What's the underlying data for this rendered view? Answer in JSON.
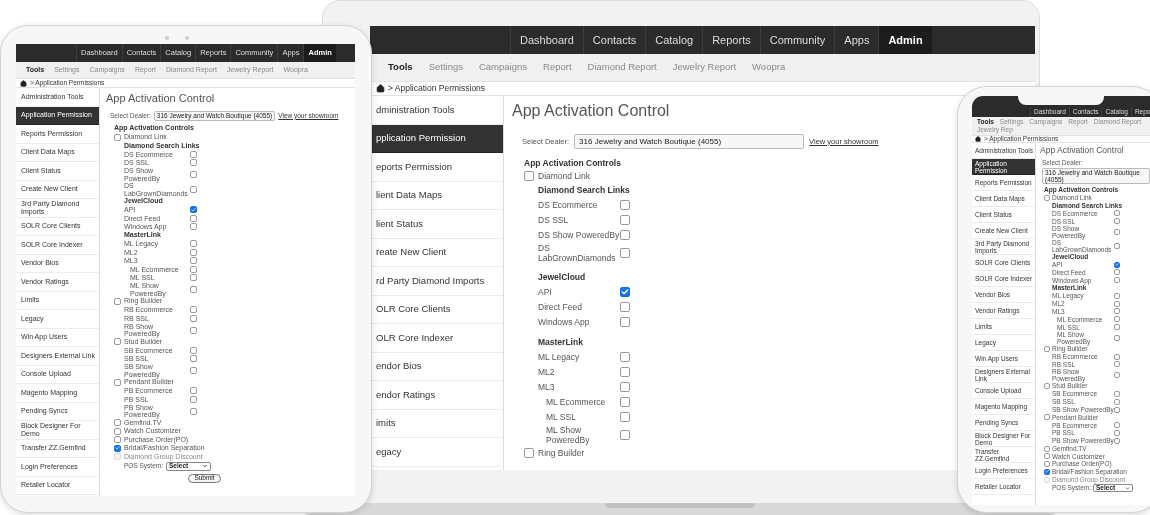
{
  "devices": [
    {
      "kind": "tablet",
      "screen": {
        "nav": [
          {
            "label": "Dashboard",
            "selected": false
          },
          {
            "label": "Contacts",
            "selected": false
          },
          {
            "label": "Catalog",
            "selected": false
          },
          {
            "label": "Reports",
            "selected": false
          },
          {
            "label": "Community",
            "selected": false
          },
          {
            "label": "Apps",
            "selected": false
          },
          {
            "label": "Admin",
            "selected": true
          }
        ],
        "subnav": [
          {
            "label": "Tools",
            "selected": true
          },
          {
            "label": "Settings",
            "selected": false
          },
          {
            "label": "Campaigns",
            "selected": false
          },
          {
            "label": "Report",
            "selected": false
          },
          {
            "label": "Diamond Report",
            "selected": false
          },
          {
            "label": "Jewelry Report",
            "selected": false
          },
          {
            "label": "Woopra",
            "selected": false
          }
        ],
        "breadcrumb": "> Application Permissions",
        "sidebar": [
          {
            "label": "Administration Tools",
            "selected": false
          },
          {
            "label": "Application Permission",
            "selected": true
          },
          {
            "label": "Reports Permission",
            "selected": false
          },
          {
            "label": "Client Data Maps",
            "selected": false
          },
          {
            "label": "Client Status",
            "selected": false
          },
          {
            "label": "Create New Client",
            "selected": false
          },
          {
            "label": "3rd Party Diamond Imports",
            "selected": false
          },
          {
            "label": "SOLR Core Clients",
            "selected": false
          },
          {
            "label": "SOLR Core Indexer",
            "selected": false
          },
          {
            "label": "Vendor Bios",
            "selected": false
          },
          {
            "label": "Vendor Ratings",
            "selected": false
          },
          {
            "label": "Limits",
            "selected": false
          },
          {
            "label": "Legacy",
            "selected": false
          },
          {
            "label": "Win App Users",
            "selected": false
          },
          {
            "label": "Designers External Link",
            "selected": false
          },
          {
            "label": "Console Upload",
            "selected": false
          },
          {
            "label": "Magento Mapping",
            "selected": false
          },
          {
            "label": "Pending Syncs",
            "selected": false
          },
          {
            "label": "Block Designer For Demo",
            "selected": false
          },
          {
            "label": "Transfer ZZ.Gemfind",
            "selected": false
          },
          {
            "label": "Login Preferences",
            "selected": false
          },
          {
            "label": "Retailer Locator",
            "selected": false
          }
        ],
        "title": "App Activation Control",
        "dealer": {
          "label": "Select Dealer:",
          "value": "316 Jewelry and Watch Boutique (4055)",
          "link": "View your showroom"
        },
        "controls_heading": "App Activation Controls",
        "controls": [
          {
            "kind": "toggle",
            "label": "Diamond Link",
            "checked": false,
            "disabled": false,
            "children": [
              {
                "kind": "heading",
                "label": "Diamond Search Links",
                "children": [
                  {
                    "kind": "option",
                    "label": "DS Ecommerce",
                    "checked": false
                  },
                  {
                    "kind": "option",
                    "label": "DS SSL",
                    "checked": false
                  },
                  {
                    "kind": "option",
                    "label": "DS Show PoweredBy",
                    "checked": false
                  },
                  {
                    "kind": "option",
                    "label": "DS LabGrownDiamonds",
                    "checked": false
                  }
                ]
              },
              {
                "kind": "heading",
                "label": "JewelCloud",
                "children": [
                  {
                    "kind": "option",
                    "label": "API",
                    "checked": true
                  },
                  {
                    "kind": "option",
                    "label": "Direct Feed",
                    "checked": false
                  },
                  {
                    "kind": "option",
                    "label": "Windows App",
                    "checked": false
                  }
                ]
              },
              {
                "kind": "heading",
                "label": "MasterLink",
                "children": [
                  {
                    "kind": "option",
                    "label": "ML Legacy",
                    "checked": false
                  },
                  {
                    "kind": "option",
                    "label": "ML2",
                    "checked": false
                  },
                  {
                    "kind": "option",
                    "label": "ML3",
                    "checked": false,
                    "children": [
                      {
                        "kind": "option",
                        "label": "ML Ecommerce",
                        "checked": false
                      },
                      {
                        "kind": "option",
                        "label": "ML SSL",
                        "checked": false
                      },
                      {
                        "kind": "option",
                        "label": "ML Show PoweredBy",
                        "checked": false
                      }
                    ]
                  }
                ]
              }
            ]
          },
          {
            "kind": "toggle",
            "label": "Ring Builder",
            "checked": false,
            "disabled": false,
            "children": [
              {
                "kind": "option",
                "label": "RB Ecommerce",
                "checked": false
              },
              {
                "kind": "option",
                "label": "RB SSL",
                "checked": false
              },
              {
                "kind": "option",
                "label": "RB Show PoweredBy",
                "checked": false
              }
            ]
          },
          {
            "kind": "toggle",
            "label": "Stud Builder",
            "checked": false,
            "disabled": false,
            "children": [
              {
                "kind": "option",
                "label": "SB Ecommerce",
                "checked": false
              },
              {
                "kind": "option",
                "label": "SB SSL",
                "checked": false
              },
              {
                "kind": "option",
                "label": "SB Show PoweredBy",
                "checked": false
              }
            ]
          },
          {
            "kind": "toggle",
            "label": "Pendant Builder",
            "checked": false,
            "disabled": false,
            "children": [
              {
                "kind": "option",
                "label": "PB Ecommerce",
                "checked": false
              },
              {
                "kind": "option",
                "label": "PB SSL",
                "checked": false
              },
              {
                "kind": "option",
                "label": "PB Show PoweredBy",
                "checked": false
              }
            ]
          },
          {
            "kind": "toggle",
            "label": "Gemfind.TV",
            "checked": false,
            "disabled": false
          },
          {
            "kind": "toggle",
            "label": "Watch Customizer",
            "checked": false,
            "disabled": false
          },
          {
            "kind": "toggle",
            "label": "Purchase Order(PO)",
            "checked": false,
            "disabled": false
          },
          {
            "kind": "toggle",
            "label": "Bridal/Fashion Separation",
            "checked": true,
            "disabled": false
          },
          {
            "kind": "toggle",
            "label": "Diamond Group Discount",
            "checked": false,
            "disabled": true
          }
        ],
        "pos": {
          "label": "POS System:",
          "value": "Select"
        },
        "submit": "Submit"
      }
    },
    {
      "kind": "laptop",
      "screen": {
        "nav": [
          {
            "label": "Dashboard",
            "selected": false
          },
          {
            "label": "Contacts",
            "selected": false
          },
          {
            "label": "Catalog",
            "selected": false
          },
          {
            "label": "Reports",
            "selected": false
          },
          {
            "label": "Community",
            "selected": false
          },
          {
            "label": "Apps",
            "selected": false
          },
          {
            "label": "Admin",
            "selected": true
          }
        ],
        "subnav": [
          {
            "label": "Tools",
            "selected": true
          },
          {
            "label": "Settings",
            "selected": false
          },
          {
            "label": "Campaigns",
            "selected": false
          },
          {
            "label": "Report",
            "selected": false
          },
          {
            "label": "Diamond Report",
            "selected": false
          },
          {
            "label": "Jewelry Report",
            "selected": false
          },
          {
            "label": "Woopra",
            "selected": false
          }
        ],
        "breadcrumb": "> Application Permissions",
        "sidebar": [
          {
            "label": "dministration Tools",
            "selected": false
          },
          {
            "label": "pplication Permission",
            "selected": true
          },
          {
            "label": "eports Permission",
            "selected": false
          },
          {
            "label": "lient Data Maps",
            "selected": false
          },
          {
            "label": "lient Status",
            "selected": false
          },
          {
            "label": "reate New Client",
            "selected": false
          },
          {
            "label": "rd Party Diamond Imports",
            "selected": false
          },
          {
            "label": "OLR Core Clients",
            "selected": false
          },
          {
            "label": "OLR Core Indexer",
            "selected": false
          },
          {
            "label": "endor Bios",
            "selected": false
          },
          {
            "label": "endor Ratings",
            "selected": false
          },
          {
            "label": "imits",
            "selected": false
          },
          {
            "label": "egacy",
            "selected": false
          }
        ],
        "title": "App Activation Control",
        "dealer": {
          "label": "Select Dealer:",
          "value": "316 Jewelry and Watch Boutique (4055)",
          "link": "View your showroom"
        },
        "controls_heading": "App Activation Controls",
        "controls": [
          {
            "kind": "toggle",
            "label": "Diamond Link",
            "checked": false,
            "disabled": false,
            "children": [
              {
                "kind": "heading",
                "label": "Diamond Search Links",
                "children": [
                  {
                    "kind": "option",
                    "label": "DS Ecommerce",
                    "checked": false
                  },
                  {
                    "kind": "option",
                    "label": "DS SSL",
                    "checked": false
                  },
                  {
                    "kind": "option",
                    "label": "DS Show PoweredBy",
                    "checked": false
                  },
                  {
                    "kind": "option",
                    "label": "DS LabGrownDiamonds",
                    "checked": false
                  }
                ]
              },
              {
                "kind": "heading",
                "label": "JewelCloud",
                "children": [
                  {
                    "kind": "option",
                    "label": "API",
                    "checked": true
                  },
                  {
                    "kind": "option",
                    "label": "Direct Feed",
                    "checked": false
                  },
                  {
                    "kind": "option",
                    "label": "Windows App",
                    "checked": false
                  }
                ]
              },
              {
                "kind": "heading",
                "label": "MasterLink",
                "children": [
                  {
                    "kind": "option",
                    "label": "ML Legacy",
                    "checked": false
                  },
                  {
                    "kind": "option",
                    "label": "ML2",
                    "checked": false
                  },
                  {
                    "kind": "option",
                    "label": "ML3",
                    "checked": false,
                    "children": [
                      {
                        "kind": "option",
                        "label": "ML Ecommerce",
                        "checked": false
                      },
                      {
                        "kind": "option",
                        "label": "ML SSL",
                        "checked": false
                      },
                      {
                        "kind": "option",
                        "label": "ML Show PoweredBy",
                        "checked": false
                      }
                    ]
                  }
                ]
              }
            ]
          },
          {
            "kind": "toggle",
            "label": "Ring Builder",
            "checked": false,
            "disabled": false
          }
        ]
      }
    },
    {
      "kind": "phone",
      "screen": {
        "nav": [
          {
            "label": "Dashboard",
            "selected": false
          },
          {
            "label": "Contacts",
            "selected": false
          },
          {
            "label": "Catalog",
            "selected": false
          },
          {
            "label": "Repo",
            "selected": false
          }
        ],
        "subnav": [
          {
            "label": "Tools",
            "selected": true
          },
          {
            "label": "Settings",
            "selected": false
          },
          {
            "label": "Campaigns",
            "selected": false
          },
          {
            "label": "Report",
            "selected": false
          },
          {
            "label": "Diamond Report",
            "selected": false
          },
          {
            "label": "Jewelry Rep",
            "selected": false
          }
        ],
        "breadcrumb": "> Application Permissions",
        "sidebar": [
          {
            "label": "Administration Tools",
            "selected": false
          },
          {
            "label": "Application Permission",
            "selected": true
          },
          {
            "label": "Reports Permission",
            "selected": false
          },
          {
            "label": "Client Data Maps",
            "selected": false
          },
          {
            "label": "Client Status",
            "selected": false
          },
          {
            "label": "Create New Client",
            "selected": false
          },
          {
            "label": "3rd Party Diamond Imports",
            "selected": false
          },
          {
            "label": "SOLR Core Clients",
            "selected": false
          },
          {
            "label": "SOLR Core Indexer",
            "selected": false
          },
          {
            "label": "Vendor Bios",
            "selected": false
          },
          {
            "label": "Vendor Ratings",
            "selected": false
          },
          {
            "label": "Limits",
            "selected": false
          },
          {
            "label": "Legacy",
            "selected": false
          },
          {
            "label": "Win App Users",
            "selected": false
          },
          {
            "label": "Designers External Link",
            "selected": false
          },
          {
            "label": "Console Upload",
            "selected": false
          },
          {
            "label": "Magento Mapping",
            "selected": false
          },
          {
            "label": "Pending Syncs",
            "selected": false
          },
          {
            "label": "Block Designer For Demo",
            "selected": false
          },
          {
            "label": "Transfer ZZ.Gemfind",
            "selected": false
          },
          {
            "label": "Login Preferences",
            "selected": false
          },
          {
            "label": "Retailer Locator",
            "selected": false
          }
        ],
        "title": "App Activation Control",
        "dealer": {
          "label": "Select Dealer:",
          "value": "316 Jewelry and Watch Boutique (4055)"
        },
        "controls_heading": "App Activation Controls",
        "controls": [
          {
            "kind": "toggle",
            "label": "Diamond Link",
            "checked": false,
            "disabled": false,
            "children": [
              {
                "kind": "heading",
                "label": "Diamond Search Links",
                "children": [
                  {
                    "kind": "option",
                    "label": "DS Ecommerce",
                    "checked": false
                  },
                  {
                    "kind": "option",
                    "label": "DS SSL",
                    "checked": false
                  },
                  {
                    "kind": "option",
                    "label": "DS Show PoweredBy",
                    "checked": false
                  },
                  {
                    "kind": "option",
                    "label": "DS LabGrownDiamonds",
                    "checked": false
                  }
                ]
              },
              {
                "kind": "heading",
                "label": "JewelCloud",
                "children": [
                  {
                    "kind": "option",
                    "label": "API",
                    "checked": true
                  },
                  {
                    "kind": "option",
                    "label": "Direct Feed",
                    "checked": false
                  },
                  {
                    "kind": "option",
                    "label": "Windows App",
                    "checked": false
                  }
                ]
              },
              {
                "kind": "heading",
                "label": "MasterLink",
                "children": [
                  {
                    "kind": "option",
                    "label": "ML Legacy",
                    "checked": false
                  },
                  {
                    "kind": "option",
                    "label": "ML2",
                    "checked": false
                  },
                  {
                    "kind": "option",
                    "label": "ML3",
                    "checked": false,
                    "children": [
                      {
                        "kind": "option",
                        "label": "ML Ecommerce",
                        "checked": false
                      },
                      {
                        "kind": "option",
                        "label": "ML SSL",
                        "checked": false
                      },
                      {
                        "kind": "option",
                        "label": "ML Show PoweredBy",
                        "checked": false
                      }
                    ]
                  }
                ]
              }
            ]
          },
          {
            "kind": "toggle",
            "label": "Ring Builder",
            "checked": false,
            "disabled": false,
            "children": [
              {
                "kind": "option",
                "label": "RB Ecommerce",
                "checked": false
              },
              {
                "kind": "option",
                "label": "RB SSL",
                "checked": false
              },
              {
                "kind": "option",
                "label": "RB Show PoweredBy",
                "checked": false
              }
            ]
          },
          {
            "kind": "toggle",
            "label": "Stud Builder",
            "checked": false,
            "disabled": false,
            "children": [
              {
                "kind": "option",
                "label": "SB Ecommerce",
                "checked": false
              },
              {
                "kind": "option",
                "label": "SB SSL",
                "checked": false
              },
              {
                "kind": "option",
                "label": "SB Show PoweredBy",
                "checked": false
              }
            ]
          },
          {
            "kind": "toggle",
            "label": "Pendant Builder",
            "checked": false,
            "disabled": false,
            "children": [
              {
                "kind": "option",
                "label": "PB Ecommerce",
                "checked": false
              },
              {
                "kind": "option",
                "label": "PB SSL",
                "checked": false
              },
              {
                "kind": "option",
                "label": "PB Show PoweredBy",
                "checked": false
              }
            ]
          },
          {
            "kind": "toggle",
            "label": "Gemfind.TV",
            "checked": false,
            "disabled": false
          },
          {
            "kind": "toggle",
            "label": "Watch Customizer",
            "checked": false,
            "disabled": false
          },
          {
            "kind": "toggle",
            "label": "Purchase Order(PO)",
            "checked": false,
            "disabled": false
          },
          {
            "kind": "toggle",
            "label": "Bridal/Fashion Separation",
            "checked": true,
            "disabled": false
          },
          {
            "kind": "toggle",
            "label": "Diamond Group Discount",
            "checked": false,
            "disabled": true
          }
        ],
        "pos": {
          "label": "POS System:",
          "value": "Select"
        }
      }
    }
  ]
}
